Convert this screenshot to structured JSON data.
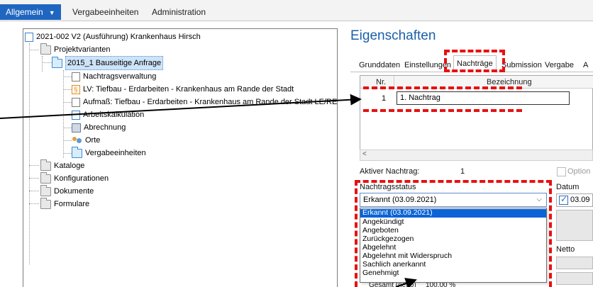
{
  "ribbon": {
    "tabs": [
      {
        "label": "Allgemein",
        "active": true
      },
      {
        "label": "Vergabeeinheiten",
        "active": false
      },
      {
        "label": "Administration",
        "active": false
      }
    ]
  },
  "tree": {
    "items": [
      {
        "label": "2021-002 V2 (Ausführung) Krankenhaus Hirsch",
        "icon": "project-icon"
      },
      {
        "label": "Projektvarianten",
        "icon": "folder-icon"
      },
      {
        "label": "2015_1 Bauseitige Anfrage",
        "icon": "variant-icon",
        "selected": true
      },
      {
        "label": "Nachtragsverwaltung",
        "icon": "document-edit-icon"
      },
      {
        "label": "LV: Tiefbau - Erdarbeiten - Krankenhaus am Rande der Stadt",
        "icon": "lv-document-icon"
      },
      {
        "label": "Aufmaß: Tiefbau - Erdarbeiten - Krankenhaus am Rande der Stadt LE/RE",
        "icon": "aufmass-icon"
      },
      {
        "label": "Arbeitskalkulation",
        "icon": "calculation-icon"
      },
      {
        "label": "Abrechnung",
        "icon": "billing-icon"
      },
      {
        "label": "Orte",
        "icon": "people-icon"
      },
      {
        "label": "Vergabeeinheiten",
        "icon": "folder-icon"
      },
      {
        "label": "Kataloge",
        "icon": "folder-icon"
      },
      {
        "label": "Konfigurationen",
        "icon": "folder-icon"
      },
      {
        "label": "Dokumente",
        "icon": "folder-icon"
      },
      {
        "label": "Formulare",
        "icon": "folder-icon"
      }
    ]
  },
  "properties": {
    "title": "Eigenschaften",
    "tabs": [
      {
        "label": "Grunddaten",
        "active": false
      },
      {
        "label": "Einstellungen",
        "active": false
      },
      {
        "label": "Nachträge",
        "active": true
      },
      {
        "label": "Submission",
        "active": false
      },
      {
        "label": "Vergabe",
        "active": false
      },
      {
        "label": "A",
        "active": false
      }
    ],
    "grid": {
      "columns": [
        "Nr.",
        "Bezeichnung"
      ],
      "rows": [
        {
          "nr": "1",
          "bezeichnung": "1. Nachtrag"
        }
      ]
    },
    "aktiver_nachtrag_label": "Aktiver Nachtrag:",
    "aktiver_nachtrag_value": "1",
    "option_label": "Option",
    "nachtragsstatus_label": "Nachtragsstatus",
    "status_selected": "Erkannt  (03.09.2021)",
    "datum_label": "Datum",
    "datum_value": "03.09",
    "datum_checked": true,
    "netto_label": "Netto",
    "status_options": [
      "Erkannt  (03.09.2021)",
      "Angekündigt",
      "Angeboten",
      "Zurückgezogen",
      "Abgelehnt",
      "Abgelehnt mit Widerspruch",
      "Sachlich anerkannt",
      "Genehmigt"
    ],
    "hidden_label_fragment": "Gesamt (netto)",
    "hidden_value_fragment": "100,00 %"
  },
  "colors": {
    "ribbon_active": "#1f66c0",
    "title_blue": "#1b5fa8",
    "annotation_red": "#e81010",
    "dropdown_selected": "#0a64d6"
  }
}
